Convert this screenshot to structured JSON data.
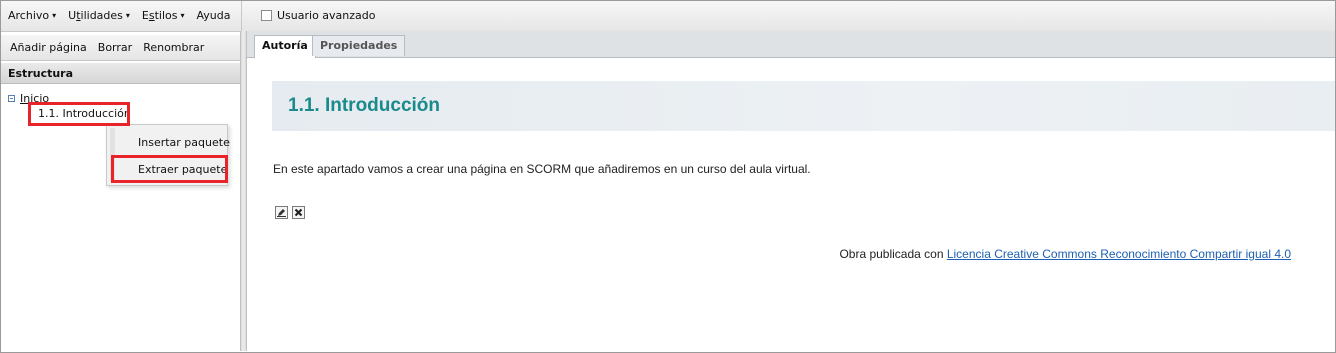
{
  "menu": [
    {
      "pre": "Archivo",
      "u": "",
      "post": "",
      "caret": "▾"
    },
    {
      "pre": "U",
      "u": "t",
      "post": "ilidades",
      "caret": "▾"
    },
    {
      "pre": "E",
      "u": "s",
      "post": "tilos",
      "caret": "▾"
    },
    {
      "pre": "Ayuda",
      "u": "",
      "post": "",
      "caret": ""
    }
  ],
  "advanced_user": {
    "label": "Usuario avanzado",
    "checked": false
  },
  "left_toolbar": {
    "add_page": "Añadir página",
    "delete": "Borrar",
    "rename": "Renombrar"
  },
  "structure": {
    "header": "Estructura",
    "root": "Inicio",
    "child": "1.1. Introducción"
  },
  "context_menu": {
    "insert": "Insertar paquete",
    "extract": "Extraer paquete"
  },
  "tabs": [
    {
      "label": "Autoría",
      "active": true
    },
    {
      "label": "Propiedades",
      "active": false
    }
  ],
  "content": {
    "title": "1.1. Introducción",
    "paragraph": "En este apartado vamos a crear una página en SCORM que añadiremos en un curso del aula virtual.",
    "license_prefix": "Obra publicada con ",
    "license_link": "Licencia Creative Commons Reconocimiento Compartir igual 4.0"
  },
  "icons": {
    "edit": "edit-pencil-icon",
    "delete": "delete-x-icon"
  },
  "colors": {
    "title": "#1b8a8c",
    "highlight": "#e8232a",
    "link": "#1f5fb0"
  }
}
